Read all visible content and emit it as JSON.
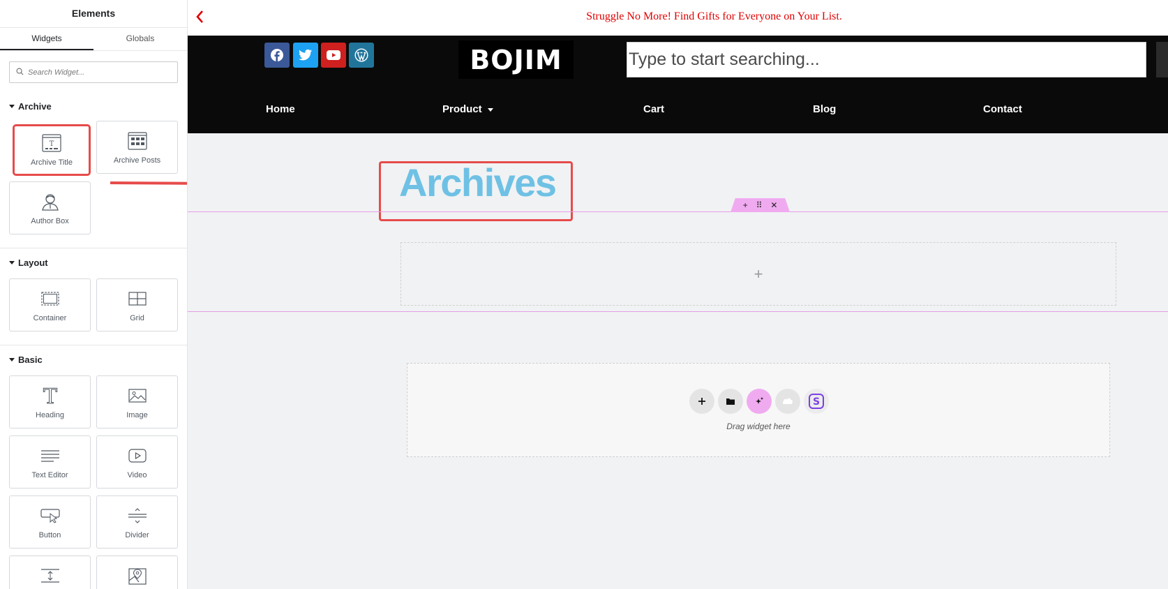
{
  "panel": {
    "title": "Elements",
    "tabs": [
      "Widgets",
      "Globals"
    ],
    "search_placeholder": "Search Widget...",
    "categories": {
      "archive": {
        "label": "Archive",
        "items": [
          "Archive Title",
          "Archive Posts",
          "Author Box"
        ]
      },
      "layout": {
        "label": "Layout",
        "items": [
          "Container",
          "Grid"
        ]
      },
      "basic": {
        "label": "Basic",
        "items": [
          "Heading",
          "Image",
          "Text Editor",
          "Video",
          "Button",
          "Divider"
        ]
      }
    }
  },
  "preview": {
    "promo": "Struggle No More! Find Gifts for Everyone on Your List.",
    "logo": "BOJIM",
    "search_placeholder": "Type to start searching...",
    "nav": [
      "Home",
      "Product",
      "Cart",
      "Blog",
      "Contact"
    ],
    "archive_title": "Archives",
    "drop_hint": "Drag widget here"
  },
  "colors": {
    "accent_red": "#e74b4b",
    "promo_red": "#e00000",
    "title_blue": "#6ec1e4",
    "section_pink": "#f0abf0",
    "facebook": "#3b5998",
    "twitter": "#1da1f2",
    "youtube": "#cd201f",
    "wordpress": "#21759b"
  }
}
